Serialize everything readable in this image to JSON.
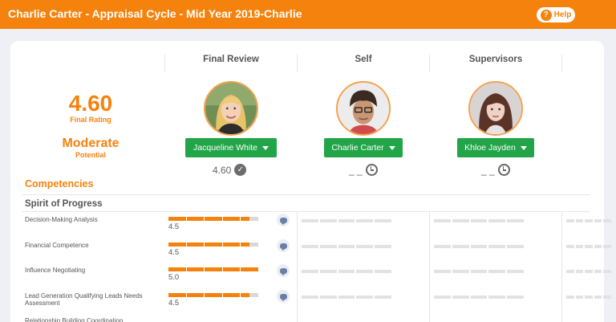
{
  "header": {
    "title": "Charlie Carter - Appraisal Cycle - Mid Year 2019-Charlie",
    "help_label": "Help",
    "help_icon": "?"
  },
  "summary": {
    "final_rating_value": "4.60",
    "final_rating_label": "Final Rating",
    "potential_value": "Moderate",
    "potential_label": "Potential"
  },
  "columns": [
    {
      "heading": "Final Review",
      "person": "Jacqueline White",
      "score": "4.60",
      "score_icon": "check-circle-icon"
    },
    {
      "heading": "Self",
      "person": "Charlie Carter",
      "score": "_ _",
      "score_icon": "clock-icon"
    },
    {
      "heading": "Supervisors",
      "person": "Khloe Jayden",
      "score": "_ _",
      "score_icon": "clock-icon"
    }
  ],
  "competencies": {
    "title": "Competencies",
    "group": "Spirit of Progress",
    "rows": [
      {
        "label": "Decision-Making Analysis",
        "value": "4.5",
        "rating": 4.5
      },
      {
        "label": "Financial Competence",
        "value": "4.5",
        "rating": 4.5
      },
      {
        "label": "Influence Negotiating",
        "value": "5.0",
        "rating": 5.0
      },
      {
        "label": "Lead Generation Qualifying Leads Needs Assessment",
        "value": "4.5",
        "rating": 4.5
      },
      {
        "label": "Relationship Building Coordination",
        "value": "",
        "rating": null
      }
    ]
  },
  "colors": {
    "accent": "#f5820c",
    "button": "#22a548",
    "background": "#eef0f6"
  }
}
